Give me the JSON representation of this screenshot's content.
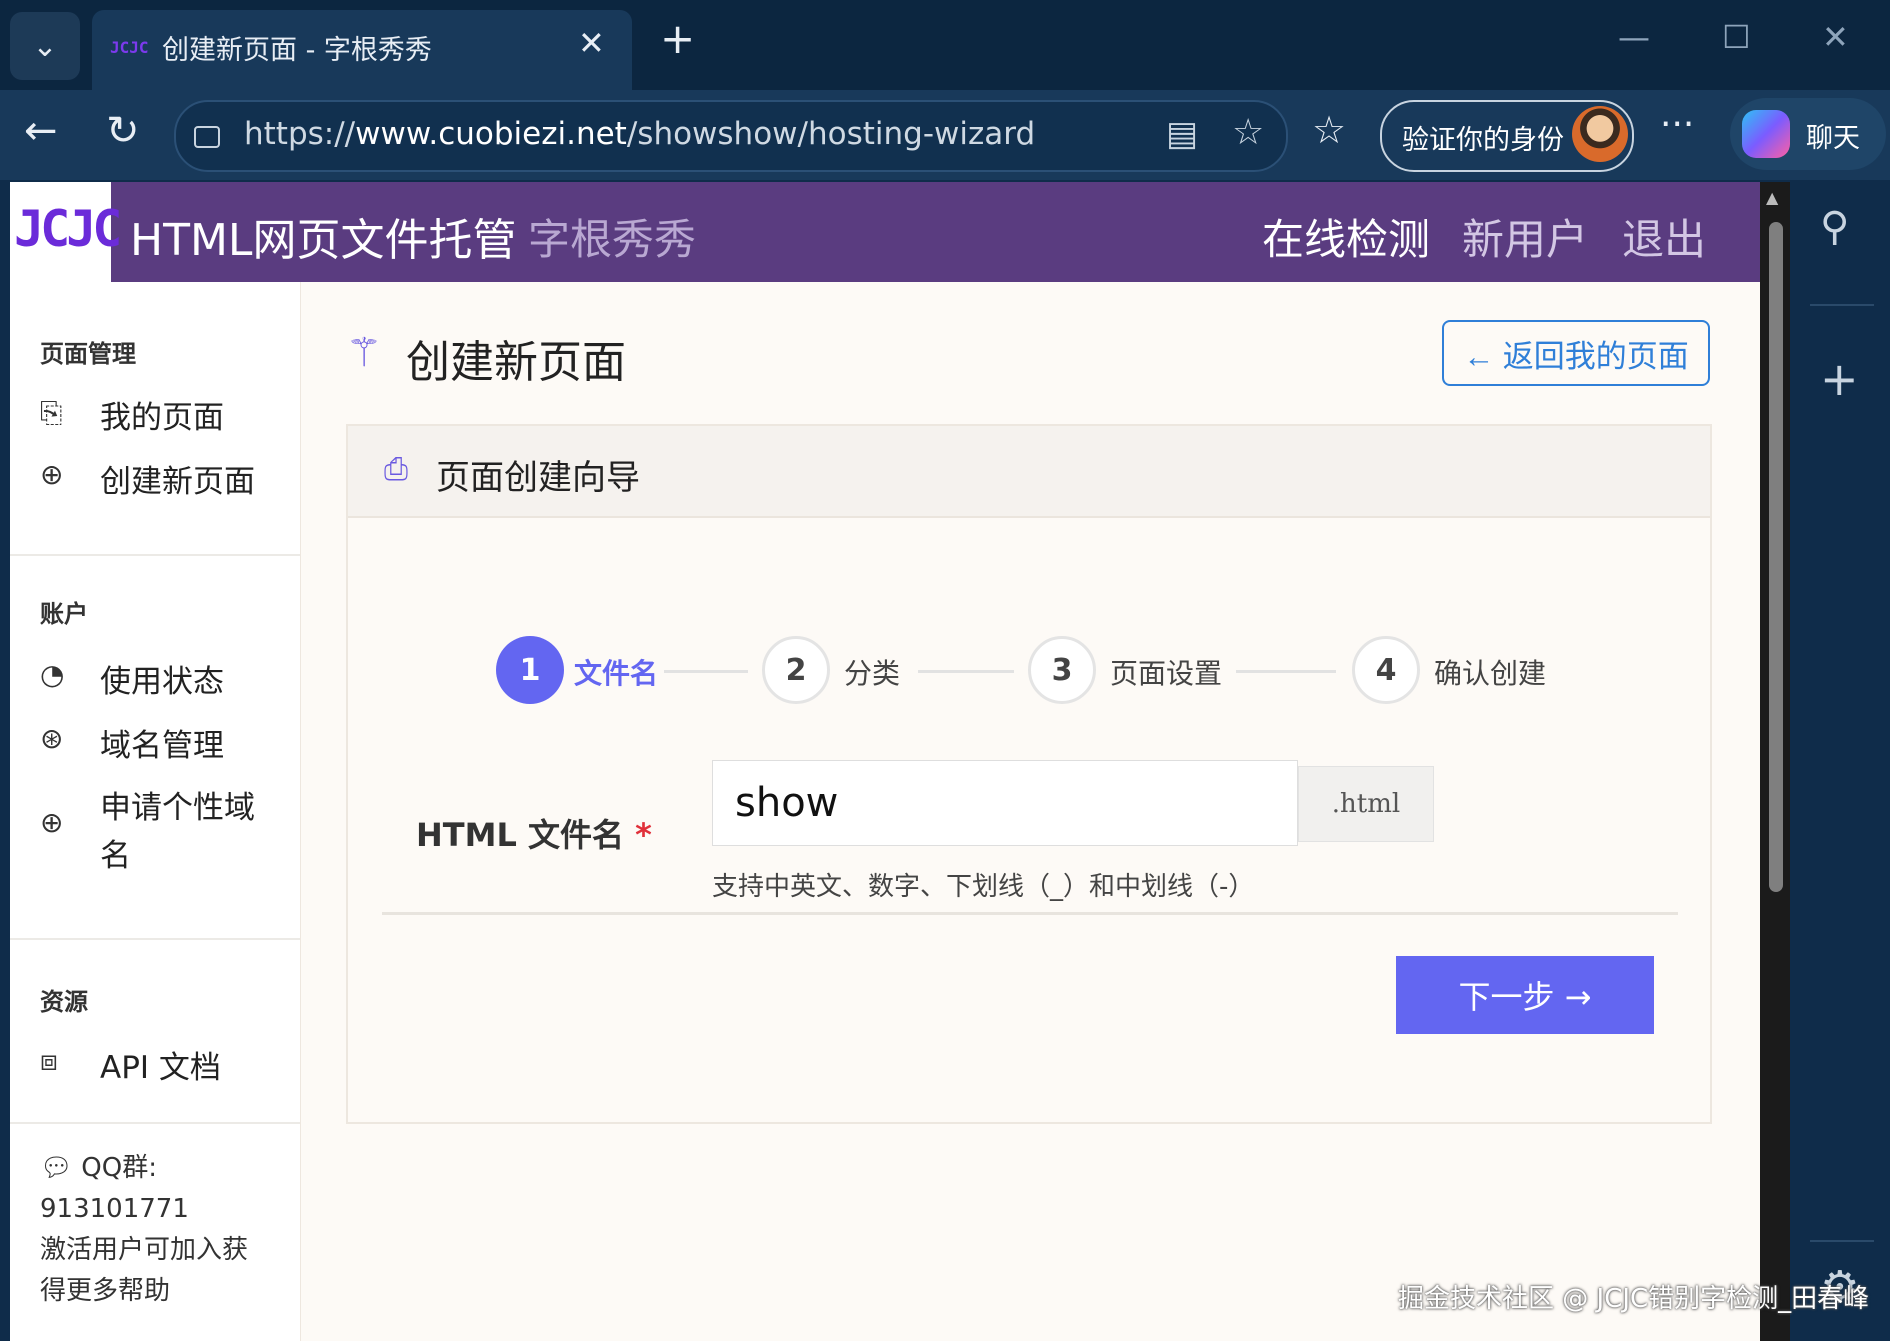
{
  "browser": {
    "tab_title": "创建新页面 - 字根秀秀",
    "tab_favicon_text": "JCJC",
    "url_scheme": "https://",
    "url_host": "www.cuobiezi.net",
    "url_path": "/showshow/hosting-wizard",
    "verify_label": "验证你的身份",
    "copilot_label": "聊天",
    "icons": [
      "tab-menu-icon",
      "close-icon",
      "new-tab-icon",
      "back-icon",
      "refresh-icon",
      "lock-icon",
      "reader-icon",
      "star-icon",
      "favorites-icon",
      "more-icon",
      "search-icon",
      "add-icon",
      "settings-icon"
    ]
  },
  "header": {
    "logo_text": "JCJC",
    "brand": "HTML网页文件托管",
    "brand_sub": "字根秀秀",
    "nav": [
      {
        "label": "在线检测"
      },
      {
        "label": "新用户"
      },
      {
        "label": "退出"
      }
    ]
  },
  "sidebar": {
    "sections": [
      {
        "title": "页面管理",
        "items": [
          {
            "label": "我的页面"
          },
          {
            "label": "创建新页面"
          }
        ]
      },
      {
        "title": "账户",
        "items": [
          {
            "label": "使用状态"
          },
          {
            "label": "域名管理"
          },
          {
            "label": "申请个性域名"
          }
        ]
      },
      {
        "title": "资源",
        "items": [
          {
            "label": "API 文档"
          }
        ]
      }
    ],
    "note_line1": "QQ群:",
    "note_line2": "913101771",
    "note_line3": "激活用户可加入获",
    "note_line4": "得更多帮助"
  },
  "main": {
    "title": "创建新页面",
    "back_button": "← 返回我的页面",
    "card_title": "页面创建向导",
    "steps": [
      {
        "num": "1",
        "label": "文件名",
        "active": true
      },
      {
        "num": "2",
        "label": "分类",
        "active": false
      },
      {
        "num": "3",
        "label": "页面设置",
        "active": false
      },
      {
        "num": "4",
        "label": "确认创建",
        "active": false
      }
    ],
    "field_label": "HTML 文件名",
    "required_mark": "*",
    "filename_value": "show",
    "extension": ".html",
    "hint": "支持中英文、数字、下划线（_）和中划线（-）",
    "next_button": "下一步 →"
  },
  "watermark": "掘金技术社区 @ JCJC错别字检测_田春峰",
  "colors": {
    "accent": "#6366f1",
    "header_bg": "#5a3c80",
    "link_blue": "#2f7fd8",
    "required": "#e0303a"
  }
}
